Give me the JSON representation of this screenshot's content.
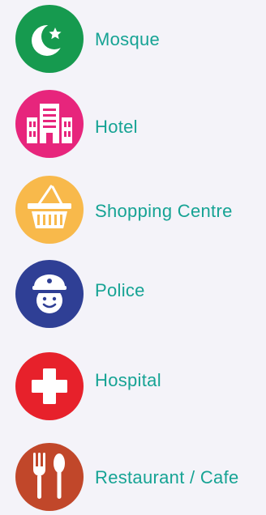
{
  "theme": {
    "background": "#f4f3f9",
    "label_color": "#16a394"
  },
  "legend": {
    "items": [
      {
        "label": "Mosque",
        "icon": "crescent-star-icon",
        "color": "#169a4f"
      },
      {
        "label": "Hotel",
        "icon": "building-icon",
        "color": "#e7257c"
      },
      {
        "label": "Shopping Centre",
        "icon": "basket-icon",
        "color": "#f8b94b"
      },
      {
        "label": "Police",
        "icon": "police-officer-icon",
        "color": "#2f3f95"
      },
      {
        "label": "Hospital",
        "icon": "medical-cross-icon",
        "color": "#e7212b"
      },
      {
        "label": "Restaurant / Cafe",
        "icon": "fork-spoon-icon",
        "color": "#c1472a"
      }
    ]
  }
}
